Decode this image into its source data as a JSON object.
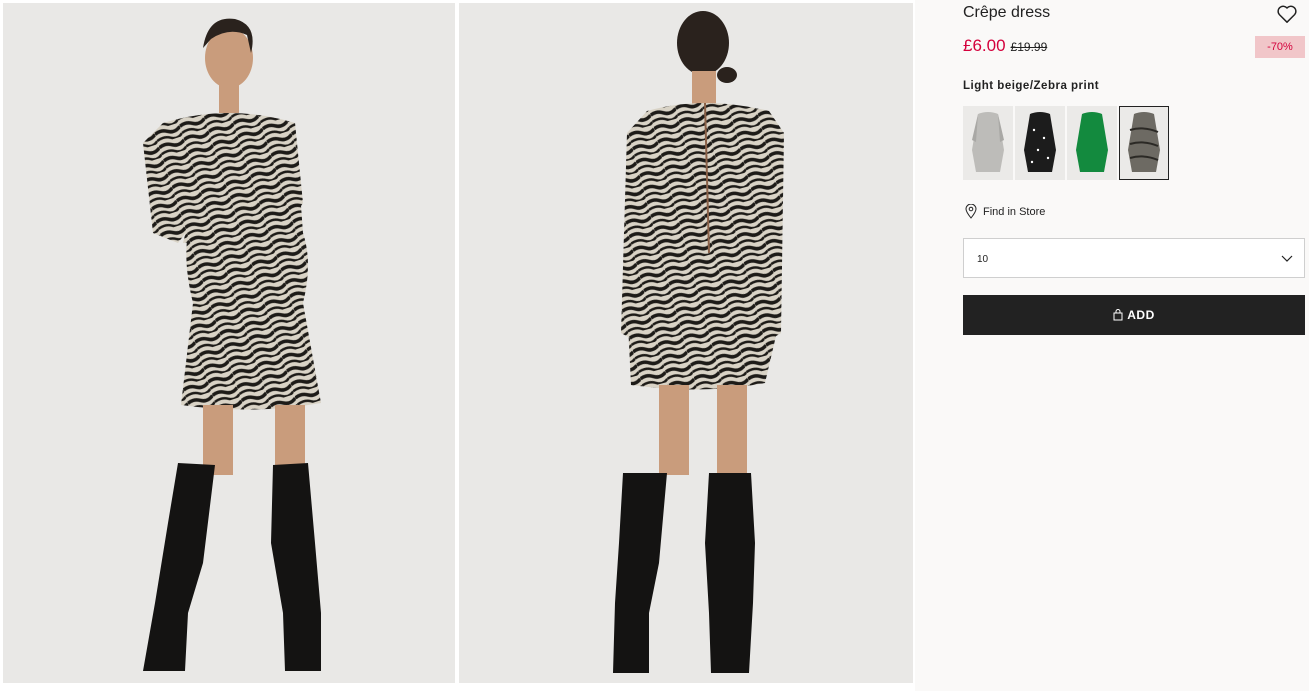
{
  "product": {
    "title": "Crêpe dress",
    "price_sale": "£6.00",
    "price_original": "£19.99",
    "discount": "-70%",
    "color_name": "Light beige/Zebra print",
    "swatches": [
      {
        "name": "light-grey-print",
        "color": "#bdbcb9"
      },
      {
        "name": "black-dot",
        "color": "#1c1c1c"
      },
      {
        "name": "green",
        "color": "#138a3e"
      },
      {
        "name": "zebra-print",
        "color": "#6d6a63"
      }
    ],
    "selected_swatch_index": 3
  },
  "store": {
    "label": "Find in Store"
  },
  "size": {
    "selected": "10"
  },
  "add_button": {
    "label": "ADD"
  },
  "colors": {
    "sale": "#d4003c",
    "badge_bg": "#f1c6c9",
    "button": "#222222"
  },
  "icons": [
    "heart-icon",
    "location-pin-icon",
    "chevron-down-icon",
    "bag-icon"
  ]
}
